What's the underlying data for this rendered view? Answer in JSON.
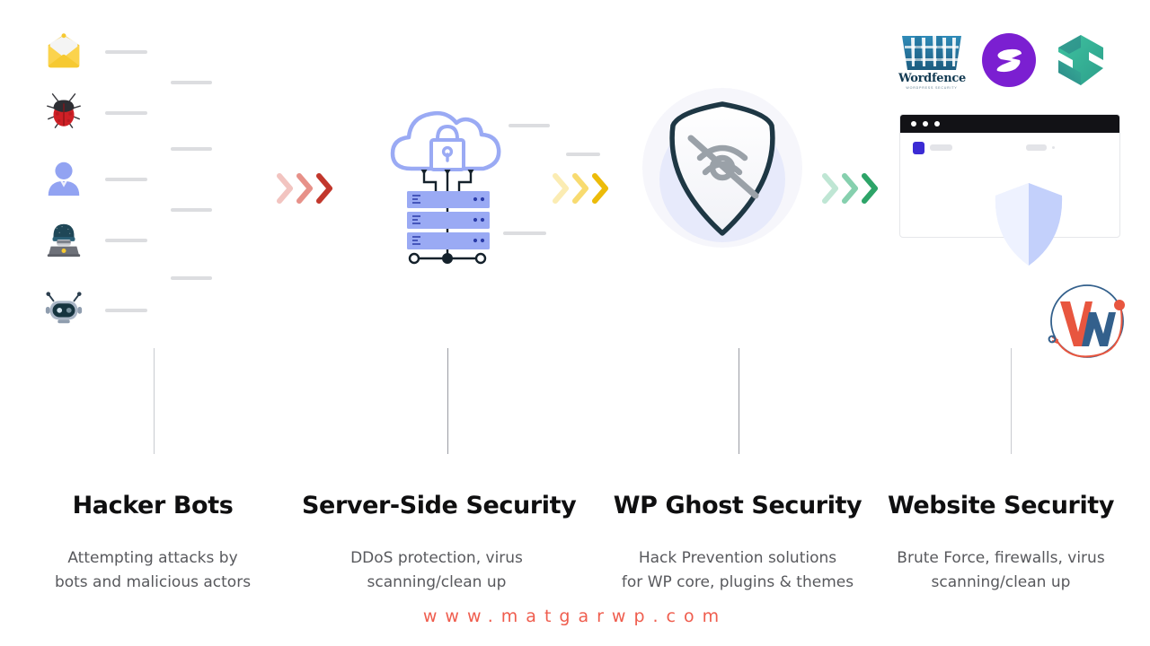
{
  "meta": {
    "background": "#ffffff",
    "accent_red": "#ef5d4e",
    "accent_yellow": "#f4c518",
    "accent_green": "#4cbf8a",
    "accent_blue": "#9aaaf4",
    "title_color": "#0f0f10",
    "desc_color": "#58595d"
  },
  "threats": {
    "icons": [
      {
        "name": "envelope-icon",
        "label": "Email"
      },
      {
        "name": "bug-icon",
        "label": "Malware bug"
      },
      {
        "name": "user-icon",
        "label": "User"
      },
      {
        "name": "hacker-icon",
        "label": "Hacker with laptop"
      },
      {
        "name": "robot-icon",
        "label": "Bot"
      }
    ]
  },
  "arrows": [
    {
      "name": "arrow-group-red",
      "color": "#d94d41",
      "count": 3
    },
    {
      "name": "arrow-group-yellow",
      "color": "#f4c518",
      "count": 3
    },
    {
      "name": "arrow-group-green",
      "color": "#3cb37c",
      "count": 3
    }
  ],
  "illustrations": {
    "cloud_lock": {
      "name": "cloud-lock-servers",
      "label": "Secure cloud with server racks"
    },
    "shield_eye": {
      "name": "shield-hidden-eye",
      "label": "Shield with hidden eye"
    },
    "browser": {
      "name": "browser-window-shield",
      "label": "Browser window protected by shield"
    }
  },
  "plugin_logos": [
    {
      "name": "wordfence-logo",
      "label": "Wordfence",
      "sublabel": "WORDPRESS SECURITY",
      "color": "#1f7aa8"
    },
    {
      "name": "sucuri-logo",
      "label": "Sucuri",
      "color": "#7b1fd1"
    },
    {
      "name": "shield-security-logo",
      "label": "Shield Security",
      "color": "#2cb79b"
    }
  ],
  "brand_logo": {
    "name": "matgarwp-logo",
    "letter_w": "W",
    "letter_m": "M",
    "w_color": "#e8563f",
    "m_color": "#33608c"
  },
  "columns": [
    {
      "title": "Hacker Bots",
      "desc_line1": "Attempting attacks by",
      "desc_line2": "bots and malicious actors"
    },
    {
      "title": "Server-Side Security",
      "desc_line1": "DDoS protection, virus",
      "desc_line2": "scanning/clean up"
    },
    {
      "title": "WP Ghost Security",
      "desc_line1": "Hack Prevention solutions",
      "desc_line2": "for WP core, plugins & themes"
    },
    {
      "title": "Website Security",
      "desc_line1": "Brute Force, firewalls, virus",
      "desc_line2": "scanning/clean up"
    }
  ],
  "watermark": {
    "text": "www.matgarwp.com"
  }
}
